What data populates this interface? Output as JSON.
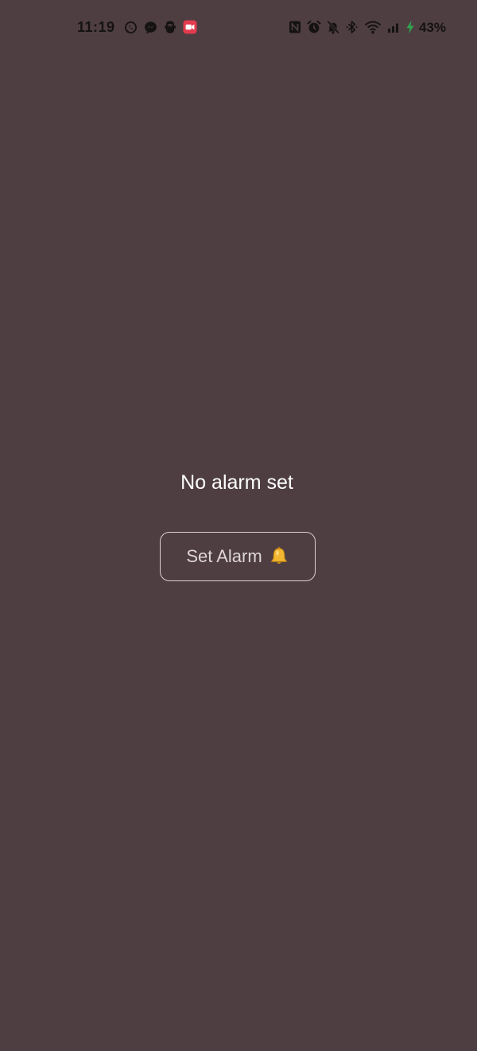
{
  "status_bar": {
    "time": "11:19",
    "battery_percent": "43%",
    "left_icons": [
      "whatsapp-icon",
      "messenger-icon",
      "robot-icon",
      "screen-record-icon"
    ],
    "right_icons": [
      "nfc-icon",
      "alarm-clock-icon",
      "do-not-disturb-icon",
      "bluetooth-icon",
      "wifi-icon",
      "signal-icon",
      "battery-charging-icon"
    ],
    "colors": {
      "text": "#151212",
      "record_badge": "#e23b4e",
      "charging": "#2fa84f"
    }
  },
  "main": {
    "empty_message": "No alarm set",
    "set_alarm_button": {
      "label": "Set Alarm",
      "icon": "bell-icon"
    }
  },
  "colors": {
    "background": "#4e3e42",
    "button_border": "#d9cfd1",
    "text_primary": "#ffffff",
    "bell": "#f2b630"
  }
}
